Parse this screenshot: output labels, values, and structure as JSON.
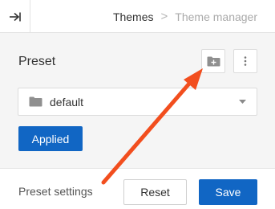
{
  "header": {
    "back_icon": "arrow-right-to-bar-icon",
    "breadcrumb": [
      "Themes",
      ">",
      "Theme manager"
    ]
  },
  "preset": {
    "title": "Preset",
    "new_folder_icon": "folder-plus-icon",
    "more_icon": "vertical-dots-icon",
    "select": {
      "icon": "folder-icon",
      "value": "default",
      "caret_icon": "caret-down-icon"
    },
    "applied_label": "Applied"
  },
  "footer": {
    "label": "Preset settings",
    "reset_label": "Reset",
    "save_label": "Save"
  },
  "colors": {
    "primary": "#1166c4",
    "panel_bg": "#f5f5f5",
    "annotation_arrow": "#f24e1e"
  }
}
